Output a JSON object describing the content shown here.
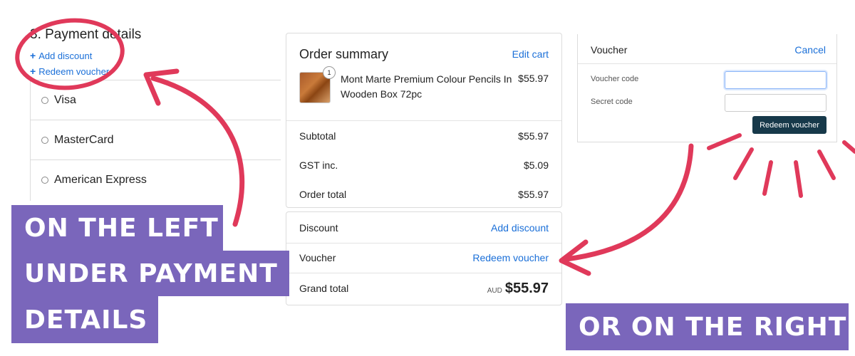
{
  "payment": {
    "title": "3. Payment details",
    "add_discount": "Add discount",
    "redeem_voucher": "Redeem voucher",
    "plus_glyph": "+",
    "methods": [
      "Visa",
      "MasterCard",
      "American Express"
    ]
  },
  "order_summary": {
    "title": "Order summary",
    "edit_cart": "Edit cart",
    "item": {
      "name": "Mont Marte Premium Colour Pencils In Wooden Box 72pc",
      "price": "$55.97",
      "quantity": "1"
    },
    "subtotal_label": "Subtotal",
    "subtotal_value": "$55.97",
    "gst_label": "GST inc.",
    "gst_value": "$5.09",
    "order_total_label": "Order total",
    "order_total_value": "$55.97",
    "discount_label": "Discount",
    "discount_action": "Add discount",
    "voucher_label": "Voucher",
    "voucher_action": "Redeem voucher",
    "grand_total_label": "Grand total",
    "currency": "AUD",
    "grand_total_value": "$55.97"
  },
  "voucher_panel": {
    "title": "Voucher",
    "cancel": "Cancel",
    "voucher_code_label": "Voucher code",
    "secret_code_label": "Secret code",
    "voucher_code_value": "",
    "secret_code_value": "",
    "submit": "Redeem voucher"
  },
  "banners": {
    "left_line1": "ON THE LEFT",
    "left_line2": "UNDER PAYMENT",
    "left_line3": "DETAILS",
    "right": "OR ON THE RIGHT"
  },
  "colors": {
    "banner": "#7a66bb",
    "annotation": "#e0395a",
    "link": "#1a6fd8",
    "button": "#17394a"
  }
}
